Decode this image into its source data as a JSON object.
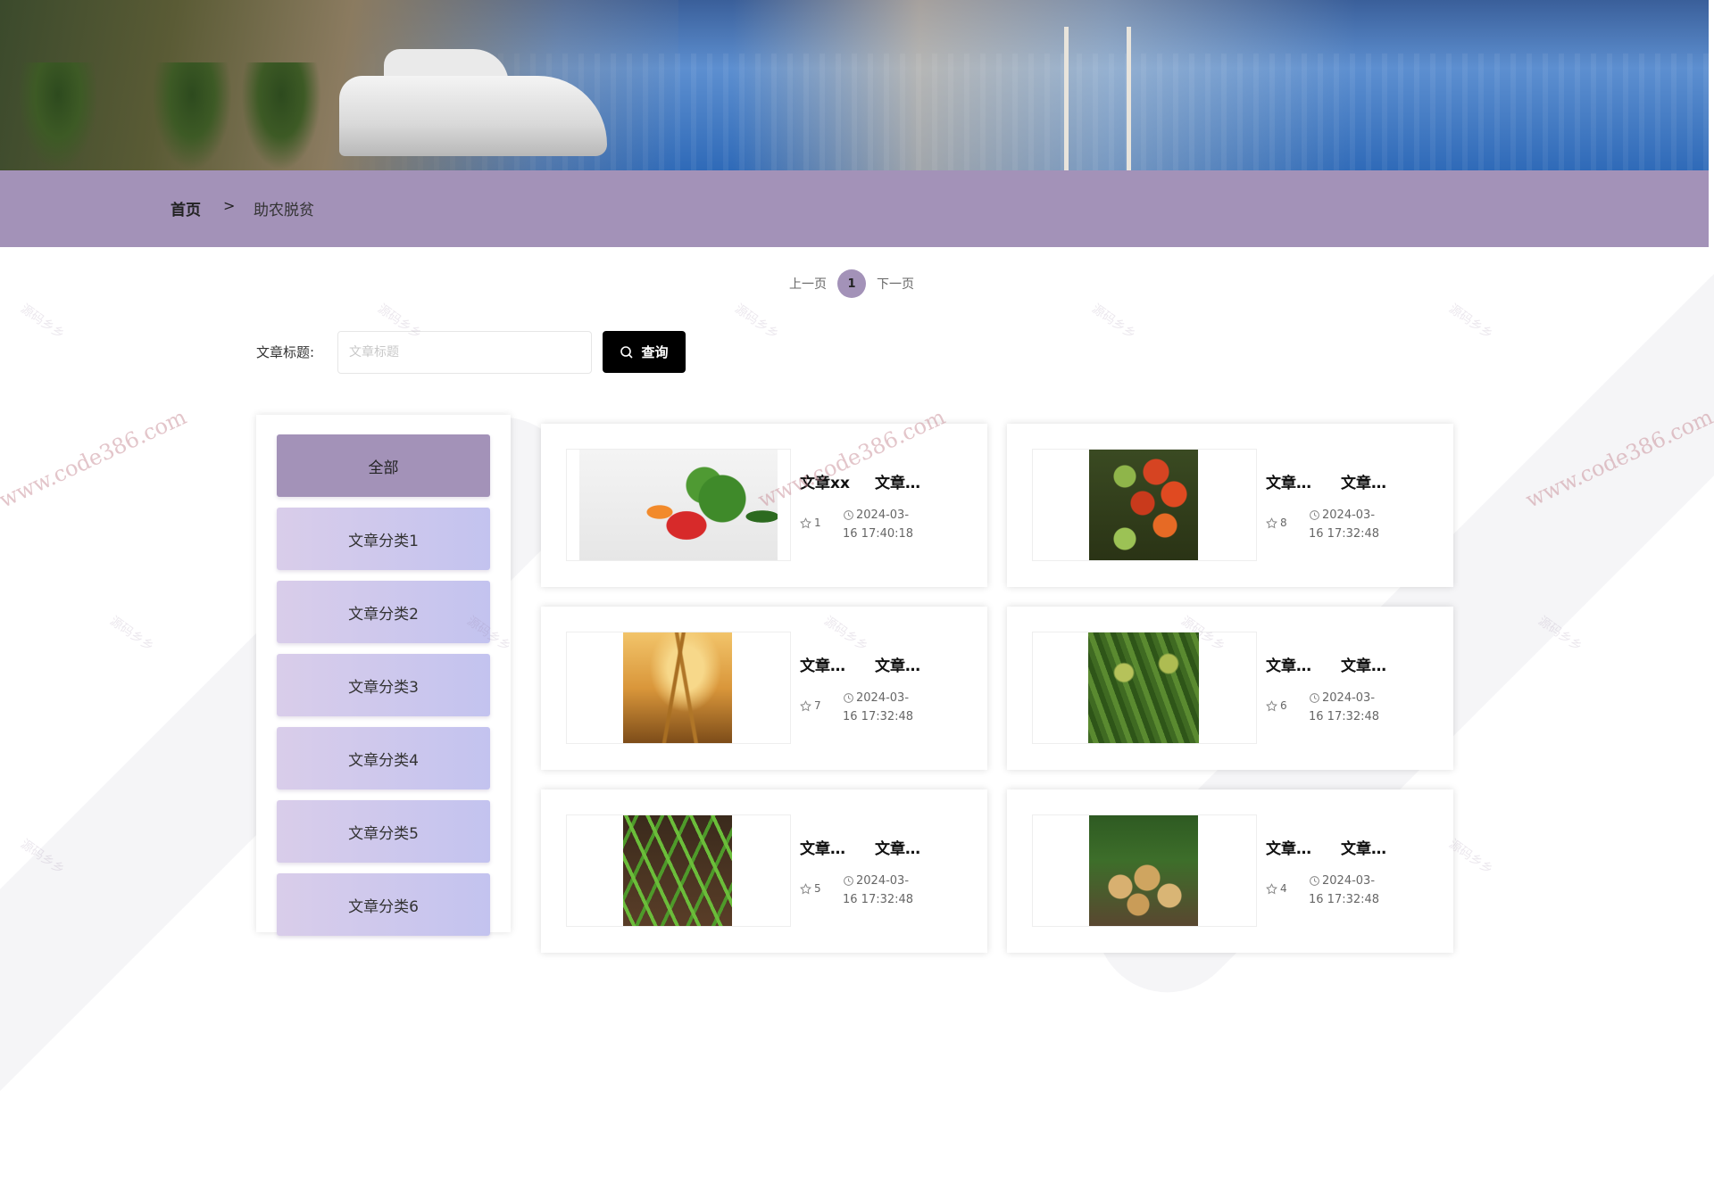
{
  "breadcrumb": {
    "home": "首页",
    "separator": ">",
    "current": "助农脱贫"
  },
  "pager": {
    "prev": "上一页",
    "current_page": "1",
    "next": "下一页"
  },
  "search": {
    "label": "文章标题:",
    "placeholder": "文章标题",
    "value": "",
    "button": "查询",
    "icon": "search-icon"
  },
  "sidebar": {
    "categories": [
      {
        "label": "全部",
        "active": true
      },
      {
        "label": "文章分类1",
        "active": false
      },
      {
        "label": "文章分类2",
        "active": false
      },
      {
        "label": "文章分类3",
        "active": false
      },
      {
        "label": "文章分类4",
        "active": false
      },
      {
        "label": "文章分类5",
        "active": false
      },
      {
        "label": "文章分类6",
        "active": false
      }
    ]
  },
  "articles": [
    {
      "title": "文章xx",
      "category": "文章…",
      "likes": "1",
      "date": "2024-03-",
      "time": "16 17:40:18",
      "image": "vegetables"
    },
    {
      "title": "文章…",
      "category": "文章…",
      "likes": "8",
      "date": "2024-03-",
      "time": "16 17:32:48",
      "image": "tomatoes"
    },
    {
      "title": "文章…",
      "category": "文章…",
      "likes": "7",
      "date": "2024-03-",
      "time": "16 17:32:48",
      "image": "wheat"
    },
    {
      "title": "文章…",
      "category": "文章…",
      "likes": "6",
      "date": "2024-03-",
      "time": "16 17:32:48",
      "image": "millet"
    },
    {
      "title": "文章…",
      "category": "文章…",
      "likes": "5",
      "date": "2024-03-",
      "time": "16 17:32:48",
      "image": "seedlings"
    },
    {
      "title": "文章…",
      "category": "文章…",
      "likes": "4",
      "date": "2024-03-",
      "time": "16 17:32:48",
      "image": "potatoes"
    }
  ],
  "watermark": {
    "text": "源码乡乡",
    "url": "www.code386.com"
  },
  "colors": {
    "accent": "#a392b8",
    "button": "#000000",
    "category_gradient_start": "#d9cdea",
    "category_gradient_end": "#c3c3ef"
  }
}
